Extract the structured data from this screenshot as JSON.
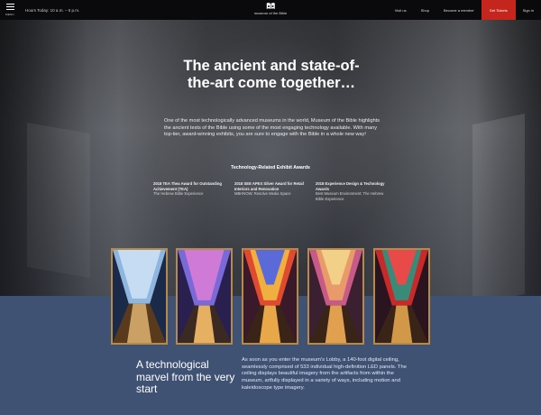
{
  "header": {
    "menu_label": "MENU",
    "hours": "Hours Today: 10 a.m. – 5 p.m.",
    "logo_name": "museum of the Bible",
    "nav": [
      {
        "label": "Visit us"
      },
      {
        "label": "Shop"
      },
      {
        "label": "Become a member"
      },
      {
        "label": "Get Tickets"
      },
      {
        "label": "Sign in"
      }
    ]
  },
  "hero": {
    "headline": "The ancient and state-of-the-art come together…",
    "intro": "One of the most technologically advanced museums in the world, Museum of the Bible highlights the ancient texts of the Bible using some of the most engaging technology available. With many top-tier, award-winning exhibits, you are sure to engage with the Bible in a whole new way!",
    "awards_title": "Technology-Related Exhibit Awards",
    "awards": [
      {
        "name": "2018 TEA Thea Award for Outstanding Achievement (TEA)",
        "for": "The Hebrew Bible Experience"
      },
      {
        "name": "2018 SEE APEX Silver Award for Retail Interiors and Renovation",
        "for": "MBHNOW: Resolve Media Space"
      },
      {
        "name": "2018 Experience Design & Technology Awards",
        "for": "Best Museum Environment: The Hebrew Bible Experience"
      }
    ]
  },
  "gallery": {
    "images": [
      {
        "alt": "ceiling-image-1",
        "accent": "#9bc4e8"
      },
      {
        "alt": "ceiling-image-2",
        "accent": "#c66ad0"
      },
      {
        "alt": "ceiling-image-3",
        "accent": "#e0463a"
      },
      {
        "alt": "ceiling-image-4",
        "accent": "#d66a95"
      },
      {
        "alt": "ceiling-image-5",
        "accent": "#d22e2e"
      }
    ]
  },
  "feature": {
    "title": "A technological marvel from the very start",
    "text": "As soon as you enter the museum's Lobby, a 140-foot digital ceiling, seamlessly comprised of 533 individual high-definition LED panels. The ceiling displays beautiful imagery from the artifacts from within the museum, artfully displayed in a variety of ways, including motion and kaleidoscope type imagery."
  },
  "colors": {
    "topbar": "#0a0a0c",
    "buy_button": "#c4261e",
    "lower_bg": "#3f5274",
    "frame_gold": "#b58b4d"
  }
}
